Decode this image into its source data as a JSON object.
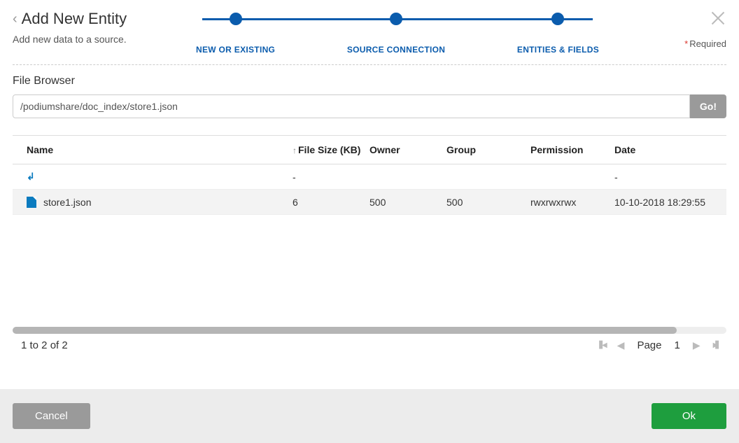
{
  "header": {
    "title": "Add New Entity",
    "subtitle": "Add new data to a source.",
    "required_label": "Required"
  },
  "stepper": {
    "steps": [
      {
        "label": "NEW OR EXISTING"
      },
      {
        "label": "SOURCE CONNECTION"
      },
      {
        "label": "ENTITIES & FIELDS"
      }
    ]
  },
  "file_browser": {
    "title": "File Browser",
    "path": "/podiumshare/doc_index/store1.json",
    "go_label": "Go!"
  },
  "table": {
    "columns": {
      "name": "Name",
      "size": "File Size (KB)",
      "owner": "Owner",
      "group": "Group",
      "permission": "Permission",
      "date": "Date"
    },
    "rows": [
      {
        "type": "up",
        "name": "",
        "size": "-",
        "owner": "",
        "group": "",
        "permission": "",
        "date": "-"
      },
      {
        "type": "file",
        "name": "store1.json",
        "size": "6",
        "owner": "500",
        "group": "500",
        "permission": "rwxrwxrwx",
        "date": "10-10-2018 18:29:55"
      }
    ]
  },
  "pager": {
    "range_text": "1 to 2 of 2",
    "page_label": "Page",
    "page_number": "1"
  },
  "footer": {
    "cancel": "Cancel",
    "ok": "Ok"
  }
}
